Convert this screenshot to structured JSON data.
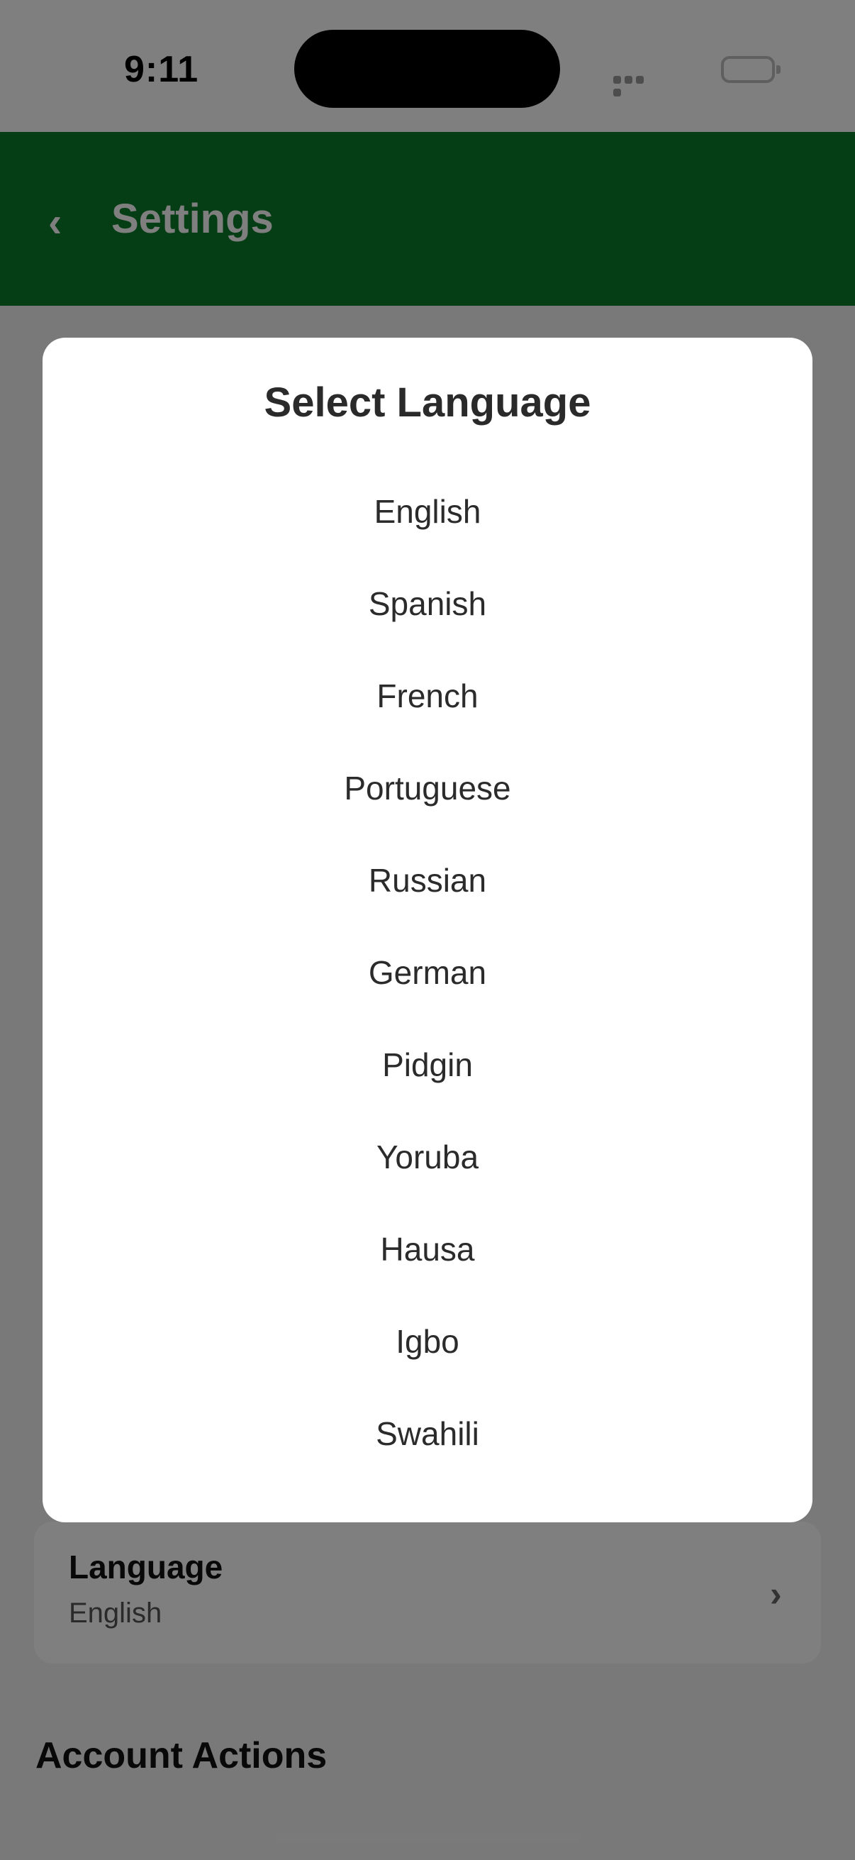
{
  "status_bar": {
    "time": "9:11"
  },
  "header": {
    "title": "Settings",
    "back_icon": "chevron-left-icon"
  },
  "settings": {
    "section_heading": "Account Actions",
    "language_row": {
      "label": "Language",
      "value": "English",
      "icon": "chevron-right-icon"
    }
  },
  "modal": {
    "title": "Select Language",
    "options": [
      "English",
      "Spanish",
      "French",
      "Portuguese",
      "Russian",
      "German",
      "Pidgin",
      "Yoruba",
      "Hausa",
      "Igbo",
      "Swahili"
    ]
  },
  "colors": {
    "header_green": "#0b7a2b",
    "scrim": "rgba(0,0,0,0.5)",
    "modal_background": "#ffffff"
  }
}
